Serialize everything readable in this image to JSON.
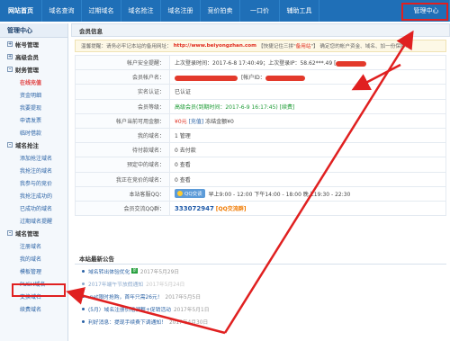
{
  "topnav": {
    "tabs": [
      "网站首页",
      "域名查询",
      "过期域名",
      "域名抢注",
      "域名注册",
      "竞价拍卖",
      "一口价",
      "辅助工具"
    ],
    "active": "管理中心"
  },
  "sidebar": {
    "title": "管理中心",
    "sections": [
      {
        "label": "帐号管理",
        "items": []
      },
      {
        "label": "高级会员",
        "items": []
      },
      {
        "label": "财务管理",
        "items": [
          "在线充值",
          "资金明细",
          "我要提现",
          "申请发票",
          "临时借款"
        ]
      },
      {
        "label": "域名抢注",
        "items": [
          "添加抢注域名",
          "我抢注的域名",
          "我参与的竞价",
          "我抢注成功的",
          "已成功的域名",
          "过期域名提醒"
        ]
      },
      {
        "label": "域名管理",
        "items": [
          "注册域名",
          "我的域名",
          "模板管理",
          "PUSH域名",
          "交换域名",
          "续费域名"
        ]
      }
    ]
  },
  "member": {
    "panel_title": "会员信息",
    "notice_prefix": "温馨提醒：请务必牢记本站的备用网址：",
    "notice_url": "http://www.beiyongzhan.com",
    "notice_mid": "【快捷记住三拼\"",
    "notice_hl": "备用站",
    "notice_suffix": "\"】 确定您的帐户资金、域名、加一份保障！",
    "rows": [
      {
        "key": "帐户安全提醒：",
        "value": "上次登录时间：2017-6-8 17:40:49；上次登录IP：58.62***.49 ["
      },
      {
        "key": "会员帐户名：",
        "value": "[帐户ID："
      },
      {
        "key": "实名认证：",
        "value": "已认证"
      },
      {
        "key": "会员等级：",
        "value": "高级会员(到期时间：2017-6-9 16:17:45) [续费]"
      },
      {
        "key": "帐户当前可用金额：",
        "value_red": "¥0元",
        "value_blue": "[充值]",
        "value_rest": "冻结金额¥0"
      },
      {
        "key": "我的域名：",
        "value": "1 管理"
      },
      {
        "key": "待付款域名：",
        "value": "0 去付款"
      },
      {
        "key": "预定中的域名：",
        "value": "0 查看"
      },
      {
        "key": "我正在竞价的域名：",
        "value": "0 查看"
      },
      {
        "key": "本站客服QQ：",
        "qq_label": "QQ交谈",
        "value": "早上9:00 - 12:00 下午14:00 - 18:00 晚上19:30 - 22:30"
      },
      {
        "key": "会员交流QQ群：",
        "value_num": "333072947",
        "value_orange": "[QQ交流群]"
      }
    ]
  },
  "announcements": {
    "title": "本站最新公告",
    "items": [
      {
        "text": "域名转出体验优化",
        "date": "2017年5月29日",
        "new": "新"
      },
      {
        "text": "2017年端午节放假通知",
        "date": "2017年5月24日"
      },
      {
        "text": ".net限时抢购，首年只需26元！",
        "date": "2017年5月5日"
      },
      {
        "text": "(5月）域名注册价格调整+促销活动",
        "date": "2017年5月1日"
      },
      {
        "text": "利好消息：提现手续费下调通知！",
        "date": "2017年4月30日"
      }
    ]
  }
}
